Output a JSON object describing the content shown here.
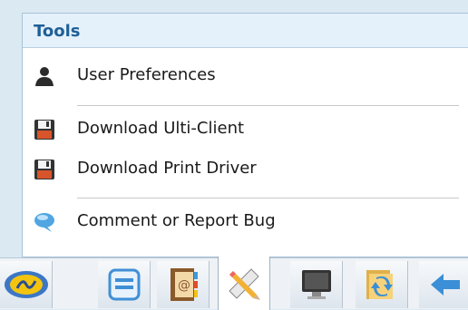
{
  "panel": {
    "title": "Tools",
    "items": [
      {
        "label": "User Preferences",
        "icon": "user-icon"
      },
      {
        "label": "Download Ulti-Client",
        "icon": "floppy-disk-icon"
      },
      {
        "label": "Download Print Driver",
        "icon": "floppy-disk-icon"
      },
      {
        "label": "Comment or Report Bug",
        "icon": "speech-bubble-icon"
      }
    ]
  },
  "taskbar": {
    "buttons": [
      {
        "icon": "app-logo-icon"
      },
      {
        "icon": "document-list-icon"
      },
      {
        "icon": "address-book-icon"
      },
      {
        "icon": "tools-pencil-ruler-icon",
        "active": true
      },
      {
        "icon": "monitor-icon"
      },
      {
        "icon": "folder-sync-icon"
      },
      {
        "icon": "back-arrow-icon"
      }
    ]
  },
  "colors": {
    "title": "#1f5f98",
    "header_bg": "#e4f1fa",
    "page_bg": "#dbe9f3"
  }
}
